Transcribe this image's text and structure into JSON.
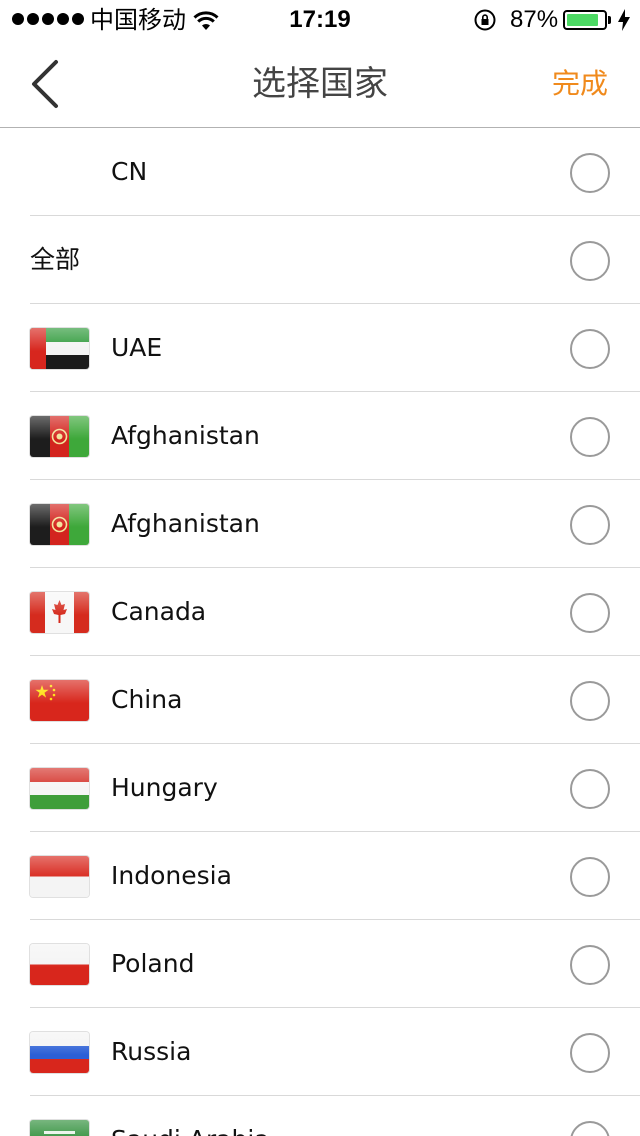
{
  "status_bar": {
    "carrier": "中国移动",
    "time": "17:19",
    "battery_percent_label": "87%",
    "battery_level": 0.87,
    "signal_dots": 5
  },
  "nav": {
    "title": "选择国家",
    "done_label": "完成",
    "back_icon": "chevron-left-icon",
    "done_color": "#f08a1c"
  },
  "list": {
    "rows": [
      {
        "label": "CN",
        "flag": null
      },
      {
        "label": "全部",
        "flag": null
      },
      {
        "label": "UAE",
        "flag": "uae-flag-icon"
      },
      {
        "label": "Afghanistan",
        "flag": "afghanistan-flag-icon"
      },
      {
        "label": "Afghanistan",
        "flag": "afghanistan-flag-icon"
      },
      {
        "label": "Canada",
        "flag": "canada-flag-icon"
      },
      {
        "label": "China",
        "flag": "china-flag-icon"
      },
      {
        "label": "Hungary",
        "flag": "hungary-flag-icon"
      },
      {
        "label": "Indonesia",
        "flag": "indonesia-flag-icon"
      },
      {
        "label": "Poland",
        "flag": "poland-flag-icon"
      },
      {
        "label": "Russia",
        "flag": "russia-flag-icon"
      },
      {
        "label": "Saudi Arabia",
        "flag": "saudi-arabia-flag-icon"
      }
    ]
  }
}
